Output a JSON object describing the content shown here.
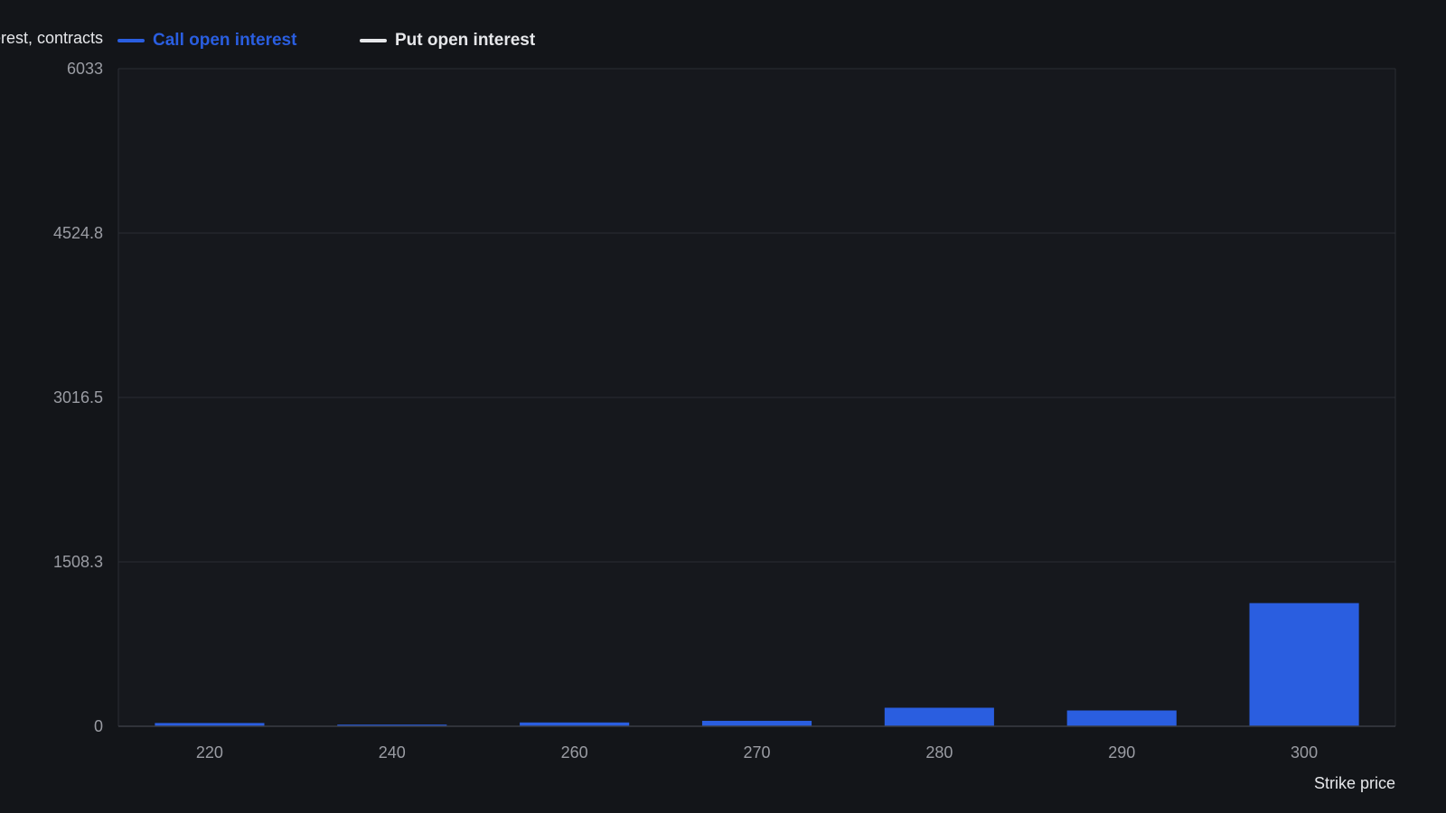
{
  "chart_data": {
    "type": "bar",
    "ylabel": "Open interest, contracts",
    "xlabel": "Strike price",
    "categories": [
      "220",
      "240",
      "260",
      "270",
      "280",
      "290",
      "300"
    ],
    "series": [
      {
        "name": "Call open interest",
        "color": "#2a5ee0",
        "values": [
          30,
          15,
          35,
          50,
          170,
          145,
          1130
        ]
      },
      {
        "name": "Put open interest",
        "color": "#e6e7ea",
        "values": [
          0,
          0,
          0,
          0,
          0,
          0,
          0
        ]
      }
    ],
    "yticks": [
      "0",
      "1508.3",
      "3016.5",
      "4524.8",
      "6033"
    ],
    "ylim": [
      0,
      6033
    ],
    "grid": true,
    "legend_position": "top-left"
  }
}
